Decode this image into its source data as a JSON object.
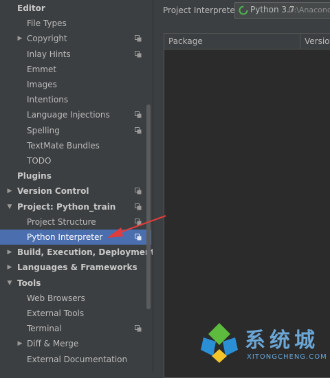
{
  "settings_tree": [
    {
      "label": "Editor",
      "level": 0,
      "bold": true,
      "arrow": "",
      "copy": false,
      "selected": false
    },
    {
      "label": "File Types",
      "level": 1,
      "bold": false,
      "arrow": "",
      "copy": false,
      "selected": false
    },
    {
      "label": "Copyright",
      "level": 1,
      "bold": false,
      "arrow": "collapsed",
      "copy": true,
      "selected": false
    },
    {
      "label": "Inlay Hints",
      "level": 1,
      "bold": false,
      "arrow": "",
      "copy": true,
      "selected": false
    },
    {
      "label": "Emmet",
      "level": 1,
      "bold": false,
      "arrow": "",
      "copy": false,
      "selected": false
    },
    {
      "label": "Images",
      "level": 1,
      "bold": false,
      "arrow": "",
      "copy": false,
      "selected": false
    },
    {
      "label": "Intentions",
      "level": 1,
      "bold": false,
      "arrow": "",
      "copy": false,
      "selected": false
    },
    {
      "label": "Language Injections",
      "level": 1,
      "bold": false,
      "arrow": "",
      "copy": true,
      "selected": false
    },
    {
      "label": "Spelling",
      "level": 1,
      "bold": false,
      "arrow": "",
      "copy": true,
      "selected": false
    },
    {
      "label": "TextMate Bundles",
      "level": 1,
      "bold": false,
      "arrow": "",
      "copy": false,
      "selected": false
    },
    {
      "label": "TODO",
      "level": 1,
      "bold": false,
      "arrow": "",
      "copy": false,
      "selected": false
    },
    {
      "label": "Plugins",
      "level": 0,
      "bold": true,
      "arrow": "",
      "copy": false,
      "selected": false
    },
    {
      "label": "Version Control",
      "level": 0,
      "bold": true,
      "arrow": "collapsed",
      "copy": true,
      "selected": false
    },
    {
      "label": "Project: Python_train",
      "level": 0,
      "bold": true,
      "arrow": "expanded",
      "copy": true,
      "selected": false
    },
    {
      "label": "Project Structure",
      "level": 1,
      "bold": false,
      "arrow": "",
      "copy": true,
      "selected": false
    },
    {
      "label": "Python Interpreter",
      "level": 1,
      "bold": false,
      "arrow": "",
      "copy": true,
      "selected": true
    },
    {
      "label": "Build, Execution, Deployment",
      "level": 0,
      "bold": true,
      "arrow": "collapsed",
      "copy": false,
      "selected": false
    },
    {
      "label": "Languages & Frameworks",
      "level": 0,
      "bold": true,
      "arrow": "collapsed",
      "copy": false,
      "selected": false
    },
    {
      "label": "Tools",
      "level": 0,
      "bold": true,
      "arrow": "expanded",
      "copy": false,
      "selected": false
    },
    {
      "label": "Web Browsers",
      "level": 1,
      "bold": false,
      "arrow": "",
      "copy": false,
      "selected": false
    },
    {
      "label": "External Tools",
      "level": 1,
      "bold": false,
      "arrow": "",
      "copy": false,
      "selected": false
    },
    {
      "label": "Terminal",
      "level": 1,
      "bold": false,
      "arrow": "",
      "copy": true,
      "selected": false
    },
    {
      "label": "Diff & Merge",
      "level": 1,
      "bold": false,
      "arrow": "collapsed",
      "copy": false,
      "selected": false
    },
    {
      "label": "External Documentation",
      "level": 1,
      "bold": false,
      "arrow": "",
      "copy": false,
      "selected": false
    }
  ],
  "interpreter": {
    "label": "Project Interpreter:",
    "name": "Python 3.7",
    "path": "D:\\Anaconda"
  },
  "packages_table": {
    "columns": [
      "Package",
      "Version"
    ],
    "rows": []
  },
  "watermark": {
    "text_cn": "系统城",
    "text_en": "XITONGCHENG.COM"
  },
  "colors": {
    "background": "#3c3f41",
    "selection": "#4b6eaf",
    "annotation_arrow": "#e03c3c",
    "watermark": "#6aa6d6"
  }
}
